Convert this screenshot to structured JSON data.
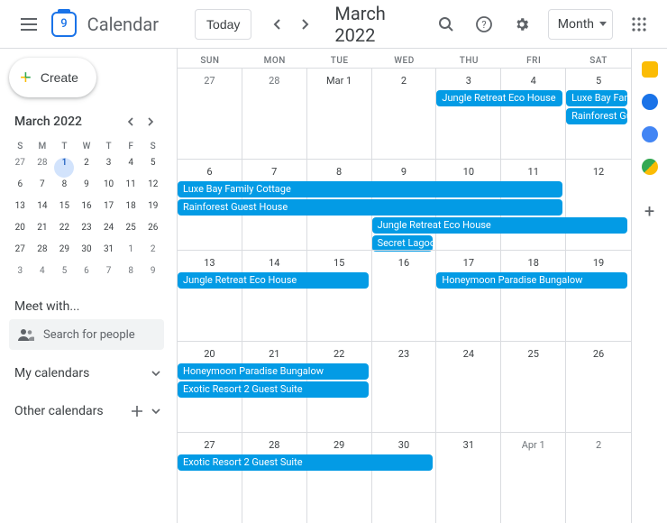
{
  "header": {
    "app_name": "Calendar",
    "logo_day": "9",
    "today": "Today",
    "title": "March 2022",
    "view": "Month"
  },
  "create": {
    "label": "Create"
  },
  "mini": {
    "title": "March 2022",
    "dow": [
      "S",
      "M",
      "T",
      "W",
      "T",
      "F",
      "S"
    ],
    "days": [
      {
        "n": "27",
        "o": true
      },
      {
        "n": "28",
        "o": true
      },
      {
        "n": "1",
        "t": true
      },
      {
        "n": "2"
      },
      {
        "n": "3"
      },
      {
        "n": "4"
      },
      {
        "n": "5"
      },
      {
        "n": "6"
      },
      {
        "n": "7"
      },
      {
        "n": "8"
      },
      {
        "n": "9"
      },
      {
        "n": "10"
      },
      {
        "n": "11"
      },
      {
        "n": "12"
      },
      {
        "n": "13"
      },
      {
        "n": "14"
      },
      {
        "n": "15"
      },
      {
        "n": "16"
      },
      {
        "n": "17"
      },
      {
        "n": "18"
      },
      {
        "n": "19"
      },
      {
        "n": "20"
      },
      {
        "n": "21"
      },
      {
        "n": "22"
      },
      {
        "n": "23"
      },
      {
        "n": "24"
      },
      {
        "n": "25"
      },
      {
        "n": "26"
      },
      {
        "n": "27"
      },
      {
        "n": "28"
      },
      {
        "n": "29"
      },
      {
        "n": "30"
      },
      {
        "n": "31"
      },
      {
        "n": "1",
        "o": true
      },
      {
        "n": "2",
        "o": true
      },
      {
        "n": "3",
        "o": true
      },
      {
        "n": "4",
        "o": true
      },
      {
        "n": "5",
        "o": true
      },
      {
        "n": "6",
        "o": true
      },
      {
        "n": "7",
        "o": true
      },
      {
        "n": "8",
        "o": true
      },
      {
        "n": "9",
        "o": true
      }
    ]
  },
  "meet": {
    "label": "Meet with...",
    "placeholder": "Search for people"
  },
  "sections": {
    "my": "My calendars",
    "other": "Other calendars"
  },
  "dow": [
    "SUN",
    "MON",
    "TUE",
    "WED",
    "THU",
    "FRI",
    "SAT"
  ],
  "weeks": [
    {
      "days": [
        {
          "n": "27",
          "o": true
        },
        {
          "n": "28",
          "o": true
        },
        {
          "n": "Mar 1"
        },
        {
          "n": "2"
        },
        {
          "n": "3"
        },
        {
          "n": "4"
        },
        {
          "n": "5"
        }
      ],
      "events": [
        {
          "label": "Jungle Retreat Eco House",
          "col": 4,
          "span": 2,
          "row": 0
        },
        {
          "label": "Luxe Bay Family Cottage",
          "col": 6,
          "span": 1,
          "row": 0
        },
        {
          "label": "Rainforest Guest House",
          "col": 6,
          "span": 1,
          "row": 1
        }
      ]
    },
    {
      "days": [
        {
          "n": "6"
        },
        {
          "n": "7"
        },
        {
          "n": "8"
        },
        {
          "n": "9"
        },
        {
          "n": "10"
        },
        {
          "n": "11"
        },
        {
          "n": "12"
        }
      ],
      "events": [
        {
          "label": "Luxe Bay Family Cottage",
          "col": 0,
          "span": 6,
          "row": 0
        },
        {
          "label": "Rainforest Guest House",
          "col": 0,
          "span": 6,
          "row": 1
        },
        {
          "label": "Jungle Retreat Eco House",
          "col": 3,
          "span": 4,
          "row": 2
        },
        {
          "label": "Secret Lagoon",
          "col": 3,
          "span": 1,
          "row": 3
        }
      ]
    },
    {
      "days": [
        {
          "n": "13"
        },
        {
          "n": "14"
        },
        {
          "n": "15"
        },
        {
          "n": "16"
        },
        {
          "n": "17"
        },
        {
          "n": "18"
        },
        {
          "n": "19"
        }
      ],
      "events": [
        {
          "label": "Jungle Retreat Eco House",
          "col": 0,
          "span": 3,
          "row": 0
        },
        {
          "label": "Honeymoon Paradise Bungalow",
          "col": 4,
          "span": 3,
          "row": 0
        }
      ]
    },
    {
      "days": [
        {
          "n": "20"
        },
        {
          "n": "21"
        },
        {
          "n": "22"
        },
        {
          "n": "23"
        },
        {
          "n": "24"
        },
        {
          "n": "25"
        },
        {
          "n": "26"
        }
      ],
      "events": [
        {
          "label": "Honeymoon Paradise Bungalow",
          "col": 0,
          "span": 3,
          "row": 0
        },
        {
          "label": "Exotic Resort 2 Guest Suite",
          "col": 0,
          "span": 3,
          "row": 1
        }
      ]
    },
    {
      "days": [
        {
          "n": "27"
        },
        {
          "n": "28"
        },
        {
          "n": "29"
        },
        {
          "n": "30"
        },
        {
          "n": "31"
        },
        {
          "n": "Apr 1",
          "o": true
        },
        {
          "n": "2",
          "o": true
        }
      ],
      "events": [
        {
          "label": "Exotic Resort 2 Guest Suite",
          "col": 0,
          "span": 4,
          "row": 0
        }
      ]
    }
  ],
  "rail_colors": [
    "#fbbc04",
    "#1a73e8",
    "#4285f4",
    "#34a853"
  ]
}
